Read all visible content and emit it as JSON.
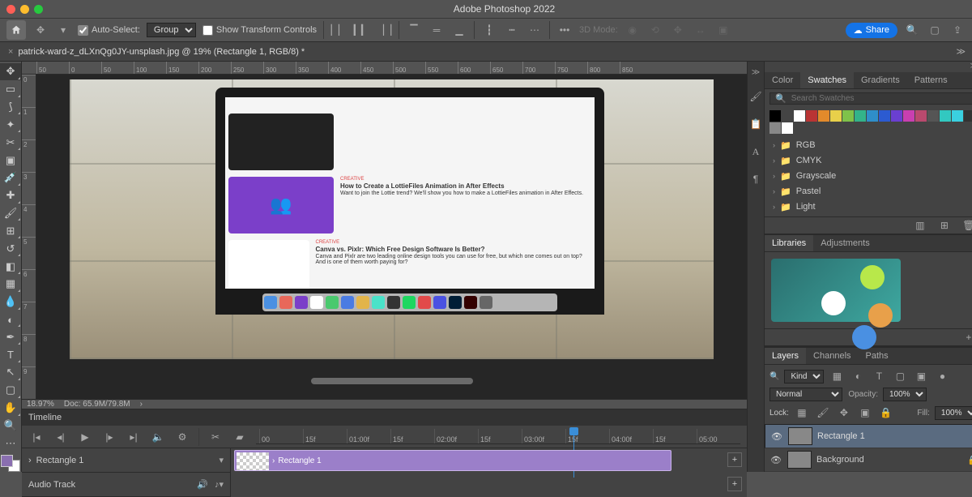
{
  "app": {
    "title": "Adobe Photoshop 2022"
  },
  "optionsBar": {
    "autoSelect": "Auto-Select:",
    "groupSelect": "Group",
    "showTransform": "Show Transform Controls",
    "mode3d": "3D Mode:",
    "share": "Share"
  },
  "document": {
    "tabTitle": "patrick-ward-z_dLXnQg0JY-unsplash.jpg @ 19% (Rectangle 1, RGB/8) *",
    "zoom": "18.97%",
    "docSize": "Doc: 65.9M/79.8M"
  },
  "rulerH": [
    "50",
    "0",
    "50",
    "100",
    "150",
    "200",
    "250",
    "300",
    "350",
    "400",
    "450",
    "500",
    "550",
    "600",
    "650",
    "700",
    "750",
    "800",
    "850"
  ],
  "rulerV": [
    "0",
    "1",
    "2",
    "3",
    "4",
    "5",
    "6",
    "7",
    "8",
    "9"
  ],
  "imacArticles": [
    {
      "cat": "CREATIVE",
      "title": "How to Create a LottieFiles Animation in After Effects",
      "desc": "Want to join the Lottie trend? We'll show you how to make a LottieFiles animation in After Effects."
    },
    {
      "cat": "CREATIVE",
      "title": "Canva vs. Pixlr: Which Free Design Software Is Better?",
      "desc": "Canva and Pixlr are two leading online design tools you can use for free, but which one comes out on top? And is one of them worth paying for?"
    }
  ],
  "timeline": {
    "title": "Timeline",
    "track1": "Rectangle 1",
    "clip1": "Rectangle 1",
    "track2": "Audio Track",
    "ticks": [
      "00",
      "15f",
      "01:00f",
      "15f",
      "02:00f",
      "15f",
      "03:00f",
      "15f",
      "04:00f",
      "15f",
      "05:00"
    ]
  },
  "rightPanel": {
    "colorTabs": [
      "Color",
      "Swatches",
      "Gradients",
      "Patterns"
    ],
    "searchPlaceholder": "Search Swatches",
    "swatchColors": [
      "#000",
      "#444",
      "#fff",
      "#b93434",
      "#e28a2b",
      "#e8d04a",
      "#7fc24a",
      "#33b38a",
      "#2f8ec9",
      "#2c5bd1",
      "#6a3fd1",
      "#c93fb0",
      "#b94a6e",
      "#555",
      "#32c8c0",
      "#3ad0e0",
      "#333",
      "#888",
      "#fff"
    ],
    "folders": [
      "RGB",
      "CMYK",
      "Grayscale",
      "Pastel",
      "Light"
    ],
    "libTabs": [
      "Libraries",
      "Adjustments"
    ],
    "layerTabs": [
      "Layers",
      "Channels",
      "Paths"
    ],
    "layerKind": "Kind",
    "blendMode": "Normal",
    "opacityLabel": "Opacity:",
    "opacity": "100%",
    "lockLabel": "Lock:",
    "fillLabel": "Fill:",
    "fill": "100%",
    "layers": [
      {
        "name": "Rectangle 1",
        "locked": false
      },
      {
        "name": "Background",
        "locked": true
      }
    ]
  },
  "tools": [
    "move",
    "marquee",
    "lasso",
    "wand",
    "crop",
    "frame",
    "eyedropper",
    "heal",
    "brush",
    "stamp",
    "history",
    "eraser",
    "gradient",
    "blur",
    "dodge",
    "pen",
    "type",
    "path",
    "rect",
    "hand",
    "zoom",
    "ellipsis"
  ]
}
